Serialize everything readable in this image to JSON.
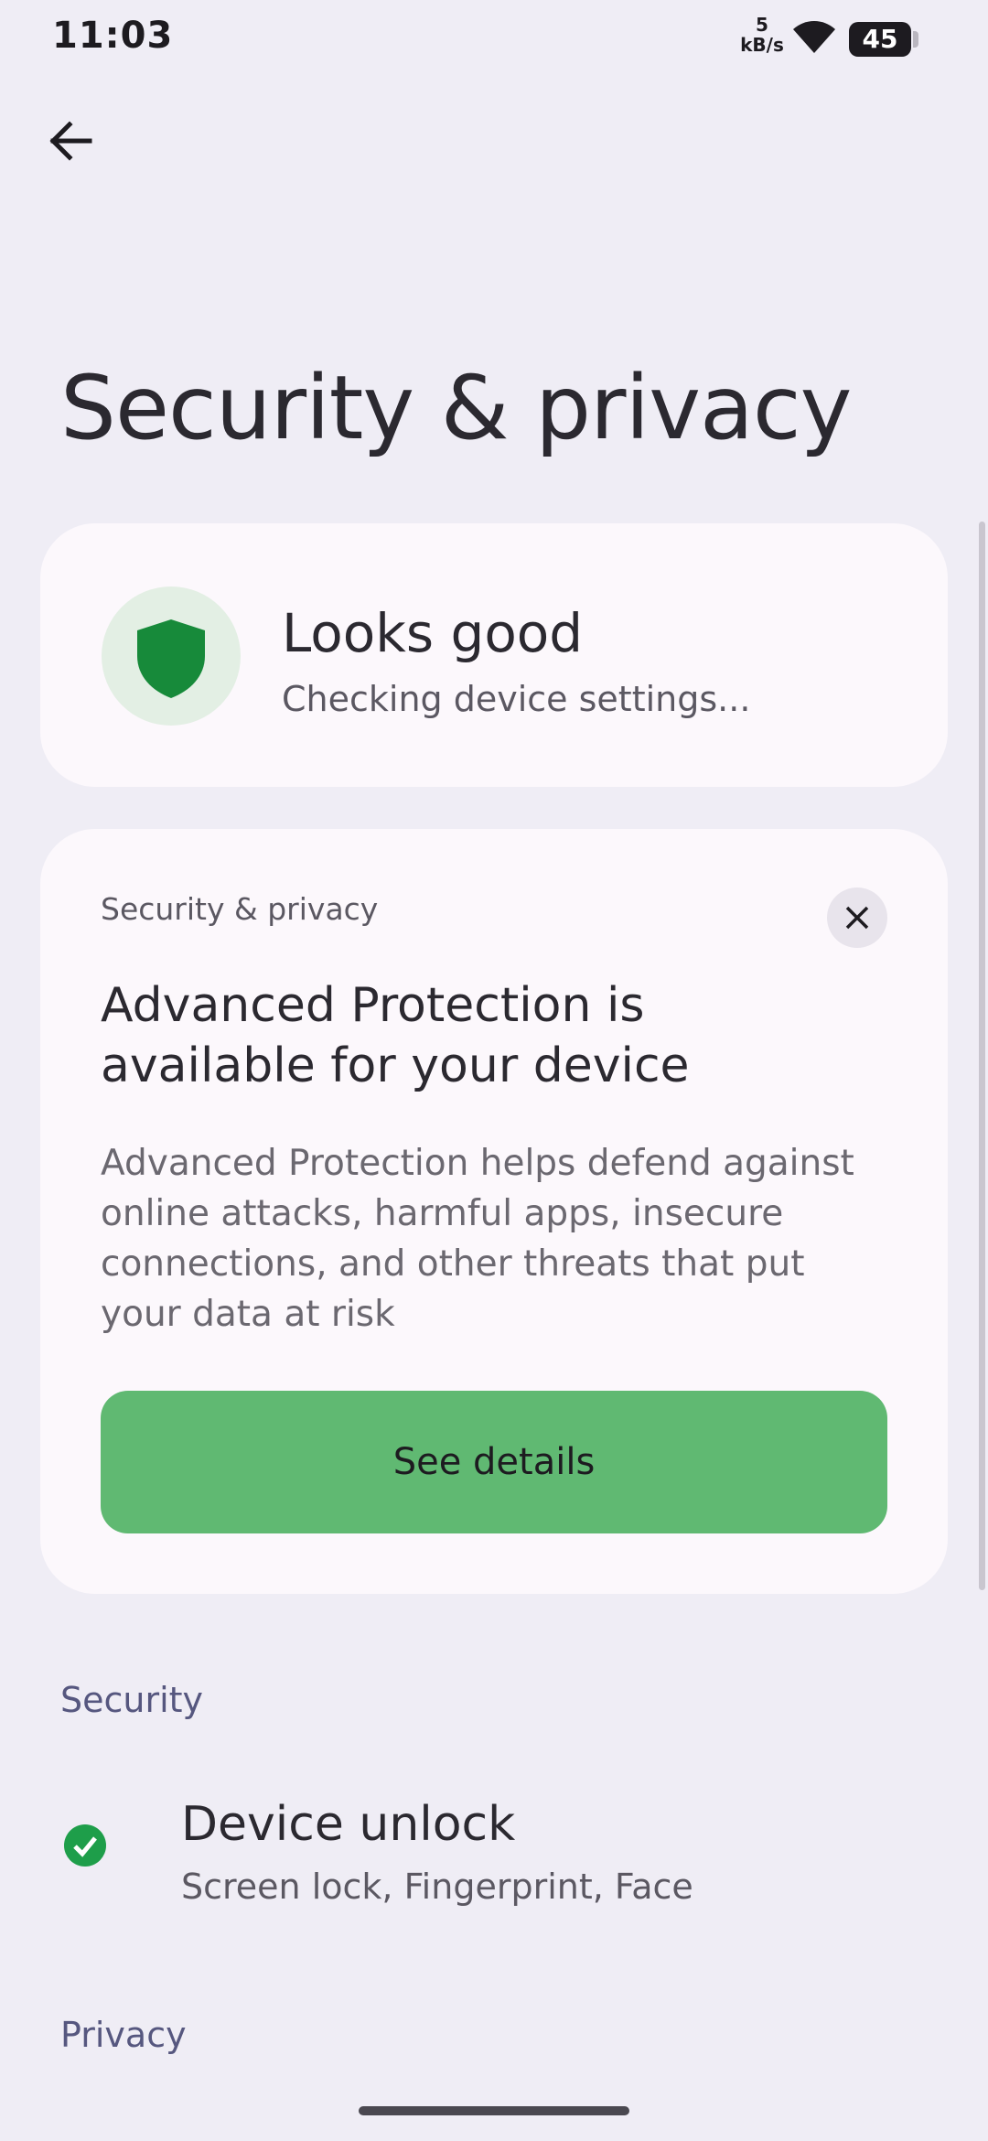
{
  "status_bar": {
    "time": "11:03",
    "net_speed_value": "5",
    "net_speed_unit": "kB/s",
    "wifi_icon": "wifi-icon",
    "battery_level": "45"
  },
  "header": {
    "back_icon": "arrow-back-icon",
    "title": "Security & privacy"
  },
  "status_card": {
    "icon": "shield-icon",
    "title": "Looks good",
    "subtitle": "Checking device settings..."
  },
  "promo_card": {
    "label": "Security & privacy",
    "close_icon": "close-icon",
    "title": "Advanced Protection is available for your device",
    "body": "Advanced Protection helps defend against online attacks, harmful apps, insecure connections, and other threats that put your data at risk",
    "button_label": "See details"
  },
  "sections": {
    "security_header": "Security",
    "privacy_header": "Privacy"
  },
  "security_items": [
    {
      "icon": "check-circle-icon",
      "title": "Device unlock",
      "subtitle": "Screen lock, Fingerprint, Face"
    }
  ],
  "colors": {
    "background": "#efedf5",
    "card": "#fcf8fc",
    "accent_green": "#60b972",
    "shield_green": "#178a3a",
    "section_header": "#56577f"
  }
}
